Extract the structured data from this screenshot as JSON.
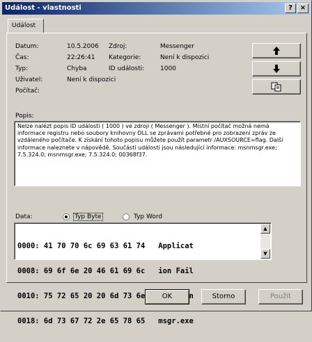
{
  "window": {
    "title": "Událost - vlastnosti",
    "help_glyph": "?",
    "close_glyph": "×"
  },
  "tab": {
    "label": "Událost"
  },
  "fields": {
    "date_label": "Datum:",
    "date_value": "10.5.2006",
    "time_label": "Čas:",
    "time_value": "22:26:41",
    "type_label": "Typ:",
    "type_value": "Chyba",
    "user_label": "Uživatel:",
    "user_value": "Není k dispozici",
    "computer_label": "Počítač:",
    "computer_value": "",
    "source_label": "Zdroj:",
    "source_value": "Messenger",
    "category_label": "Kategorie:",
    "category_value": "Není k dispozici",
    "event_id_label": "ID události:",
    "event_id_value": "1000"
  },
  "nav": {
    "up_glyph": "🠉",
    "down_glyph": "🠋",
    "copy_icon": "copy-icon"
  },
  "description": {
    "label": "Popis:",
    "text": "Nelze nalézt popis ID události ( 1000 ) ve zdroji ( Messenger ). Místní počítač možná nemá informace registru nebo soubory knihovny DLL se zprávami potřebné pro zobrazení zpráv ze vzdáleného počítače. K získání tohoto popisu můžete použít parametr /AUXSOURCE=flag. Další informace naleznete v nápovědě. Součásti události jsou následující informace: msnmsgr.exe; 7.5.324.0; msnmsgr.exe; 7.5.324.0; 00368f37."
  },
  "data": {
    "label": "Data:",
    "bytes_option": "Typ Byte",
    "words_option": "Typ Word",
    "selected": "bytes",
    "rows": [
      "0000: 41 70 70 6c 69 63 61 74   Applicat",
      "0008: 69 6f 6e 20 46 61 69 6c   ion Fail",
      "0010: 75 72 65 20 20 6d 73 6e   ure  msn",
      "0018: 6d 73 67 72 2e 65 78 65   msgr.exe"
    ]
  },
  "buttons": {
    "ok": "OK",
    "cancel": "Storno",
    "apply": "Použít"
  }
}
